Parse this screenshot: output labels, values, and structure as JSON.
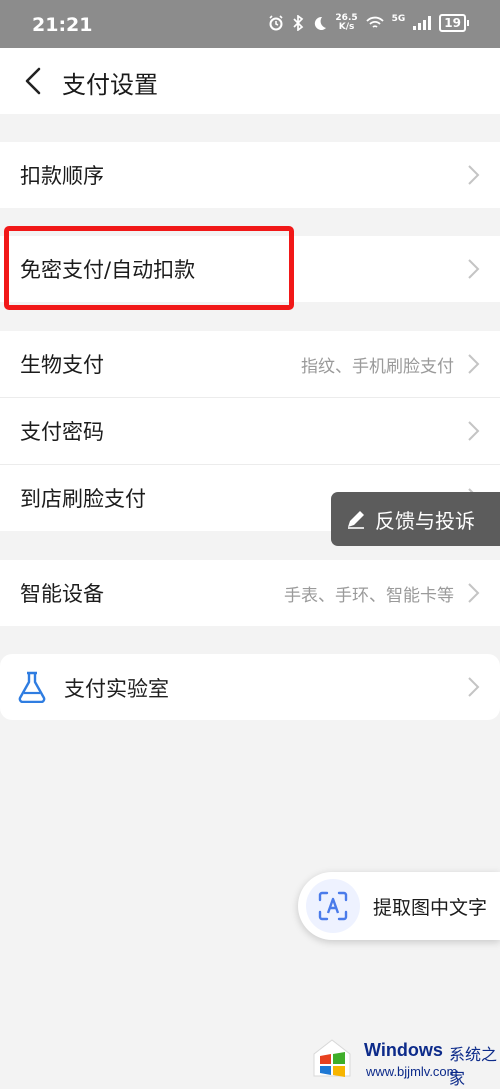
{
  "status_bar": {
    "time": "21:21",
    "net_speed_value": "26.5",
    "net_speed_unit": "K/s",
    "network_type": "5G",
    "battery": "19"
  },
  "header": {
    "title": "支付设置"
  },
  "groups": [
    {
      "rows": [
        {
          "label": "扣款顺序",
          "value": ""
        }
      ]
    },
    {
      "rows": [
        {
          "label": "免密支付/自动扣款",
          "value": ""
        }
      ]
    },
    {
      "rows": [
        {
          "label": "生物支付",
          "value": "指纹、手机刷脸支付"
        },
        {
          "label": "支付密码",
          "value": ""
        },
        {
          "label": "到店刷脸支付",
          "value": ""
        }
      ]
    },
    {
      "rows": [
        {
          "label": "智能设备",
          "value": "手表、手环、智能卡等"
        }
      ]
    }
  ],
  "lab": {
    "label": "支付实验室",
    "icon": "flask-icon"
  },
  "feedback_button": {
    "label": "反馈与投诉",
    "icon": "pen-icon"
  },
  "ocr_button": {
    "label": "提取图中文字",
    "icon": "text-scan-icon"
  },
  "watermark": {
    "brand": "Windows",
    "tag": "系统之家",
    "url": "www.bjjmlv.com"
  },
  "colors": {
    "status_bar_bg": "#8c8c8c",
    "page_bg": "#f3f3f3",
    "highlight": "#f11818",
    "feedback_bg": "#5c5c5c",
    "accent_blue": "#2f7de1"
  }
}
